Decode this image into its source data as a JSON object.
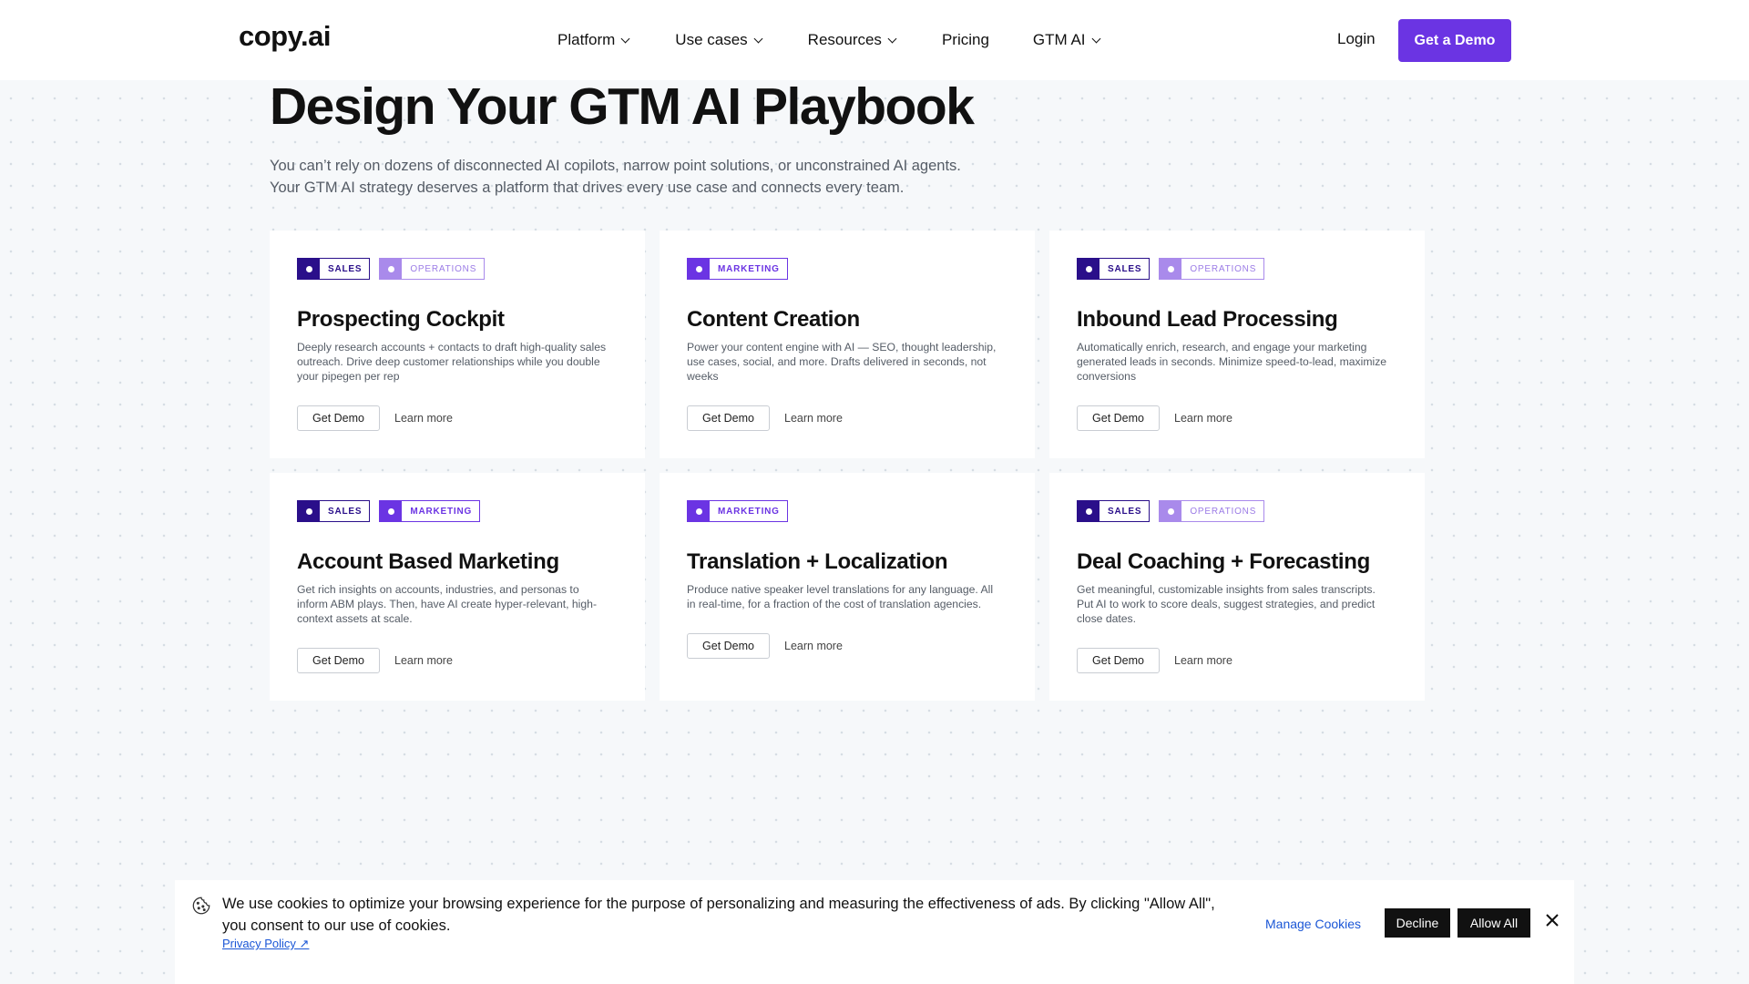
{
  "nav": {
    "logo": "copy.ai",
    "items": [
      {
        "label": "Platform",
        "dropdown": true
      },
      {
        "label": "Use cases",
        "dropdown": true
      },
      {
        "label": "Resources",
        "dropdown": true
      },
      {
        "label": "Pricing",
        "dropdown": false
      },
      {
        "label": "GTM AI",
        "dropdown": true
      }
    ],
    "login": "Login",
    "cta": "Get a Demo",
    "accent_color": "#6b34e3"
  },
  "hero": {
    "title": "Design Your GTM AI Playbook",
    "subtitle_line1": "You can’t rely on dozens of disconnected AI copilots, narrow point solutions, or unconstrained AI agents.",
    "subtitle_line2": "Your GTM AI strategy deserves a platform that drives every use case and connects every team."
  },
  "cards": [
    {
      "tags": [
        {
          "label": "SALES",
          "kind": "sales"
        },
        {
          "label": "OPERATIONS",
          "kind": "ops"
        }
      ],
      "title": "Prospecting Cockpit",
      "desc": "Deeply research accounts + contacts to draft high-quality sales outreach. Drive deep customer relationships while you double your pipegen per rep",
      "demo": "Get Demo",
      "learn": "Learn more"
    },
    {
      "tags": [
        {
          "label": "MARKETING",
          "kind": "mkt"
        }
      ],
      "title": "Content Creation",
      "desc": "Power your content engine with AI — SEO, thought leadership, use cases, social, and more. Drafts delivered in seconds, not weeks",
      "demo": "Get Demo",
      "learn": "Learn more"
    },
    {
      "tags": [
        {
          "label": "SALES",
          "kind": "sales"
        },
        {
          "label": "OPERATIONS",
          "kind": "ops"
        }
      ],
      "title": "Inbound Lead Processing",
      "desc": "Automatically enrich, research, and engage your marketing generated leads in seconds. Minimize speed-to-lead, maximize conversions",
      "demo": "Get Demo",
      "learn": "Learn more"
    },
    {
      "tags": [
        {
          "label": "SALES",
          "kind": "sales"
        },
        {
          "label": "MARKETING",
          "kind": "mkt"
        }
      ],
      "title": "Account Based Marketing",
      "desc": "Get rich insights on accounts, industries, and personas to inform ABM plays. Then, have AI create hyper-relevant, high-context assets at scale.",
      "demo": "Get Demo",
      "learn": "Learn more"
    },
    {
      "tags": [
        {
          "label": "MARKETING",
          "kind": "mkt"
        }
      ],
      "title": "Translation + Localization",
      "desc": "Produce native speaker level translations for any language. All in real-time, for a fraction of the cost of translation agencies.",
      "demo": "Get Demo",
      "learn": "Learn more"
    },
    {
      "tags": [
        {
          "label": "SALES",
          "kind": "sales"
        },
        {
          "label": "OPERATIONS",
          "kind": "ops"
        }
      ],
      "title": "Deal Coaching + Forecasting",
      "desc": "Get meaningful, customizable insights from sales transcripts. Put AI to work to score deals, suggest strategies, and predict close dates.",
      "demo": "Get Demo",
      "learn": "Learn more"
    }
  ],
  "cookie": {
    "text": "We use cookies to optimize your browsing experience for the purpose of personalizing and measuring the effectiveness of ads. By clicking \"Allow All\", you consent to our use of cookies.",
    "privacy": "Privacy Policy ↗",
    "manage": "Manage Cookies",
    "decline": "Decline",
    "allow": "Allow All",
    "icon": "cookie-icon"
  }
}
